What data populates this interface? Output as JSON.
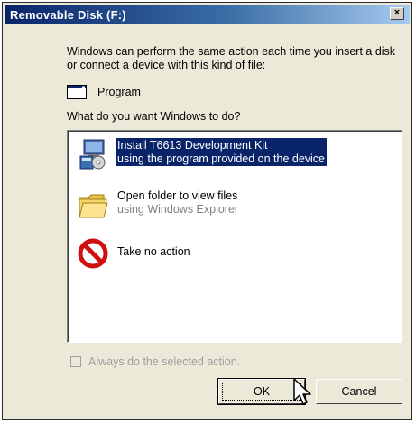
{
  "window": {
    "title": "Removable Disk (F:)",
    "close_label": "×"
  },
  "dialog": {
    "description": "Windows can perform the same action each time you insert a disk or connect a device with this kind of file:",
    "content_type": "Program",
    "question": "What do you want Windows to do?"
  },
  "actions": [
    {
      "title": "Install T6613 Development Kit",
      "subtitle": "using the program provided on the device",
      "icon": "installer-icon",
      "selected": true
    },
    {
      "title": "Open folder to view files",
      "subtitle": "using Windows Explorer",
      "icon": "folder-icon",
      "selected": false
    },
    {
      "title": "Take no action",
      "subtitle": "",
      "icon": "no-action-icon",
      "selected": false
    }
  ],
  "checkbox": {
    "label": "Always do the selected action.",
    "checked": false,
    "enabled": false
  },
  "buttons": {
    "ok": "OK",
    "cancel": "Cancel"
  },
  "colors": {
    "titlebar_start": "#0a246a",
    "titlebar_end": "#a6caf0",
    "selection": "#0a246a",
    "dialog_bg": "#ece9d8"
  }
}
